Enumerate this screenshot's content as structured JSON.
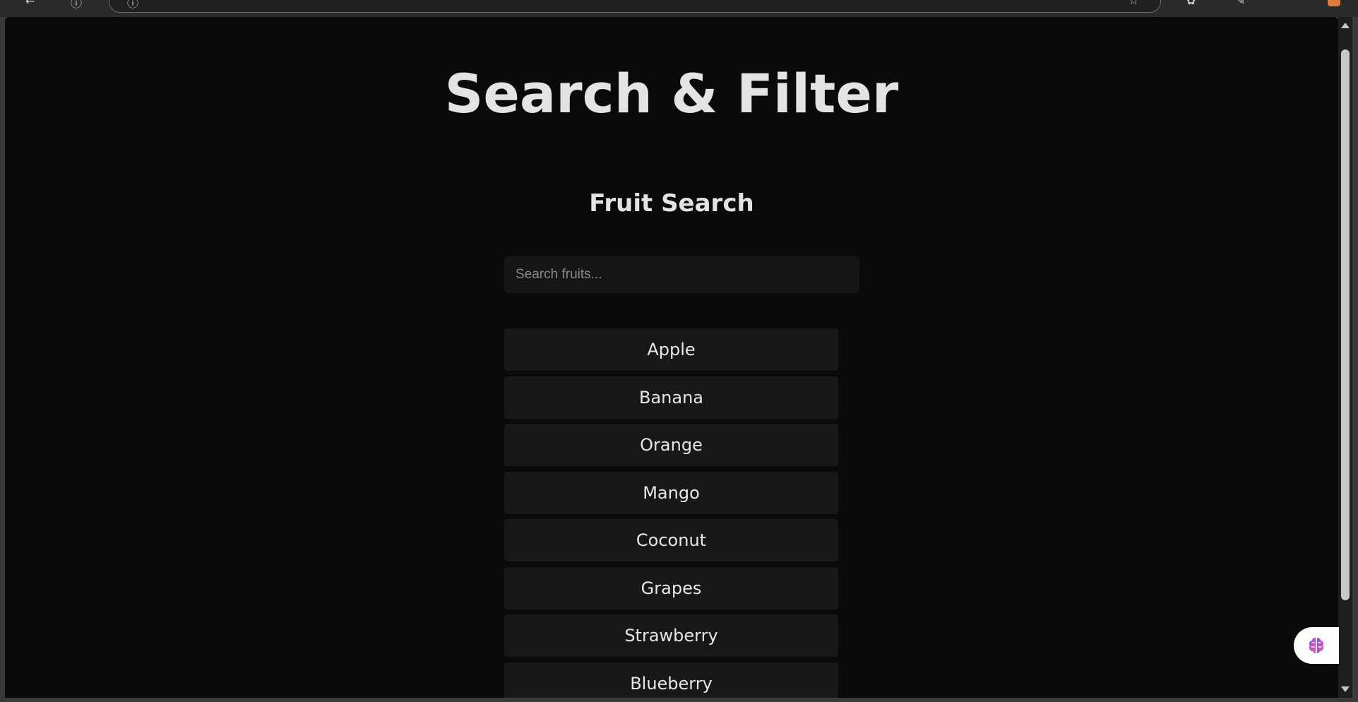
{
  "page": {
    "title": "Search & Filter",
    "section_title": "Fruit Search"
  },
  "search": {
    "placeholder": "Search fruits...",
    "value": ""
  },
  "fruits": [
    "Apple",
    "Banana",
    "Orange",
    "Mango",
    "Coconut",
    "Grapes",
    "Strawberry",
    "Blueberry"
  ],
  "colors": {
    "background": "#0a0a0a",
    "card": "#181818",
    "text": "#e3e3e3",
    "assistant_accent_1": "#7b4dff",
    "assistant_accent_2": "#ff4fa0"
  },
  "icons": {
    "assistant": "brain-icon"
  }
}
